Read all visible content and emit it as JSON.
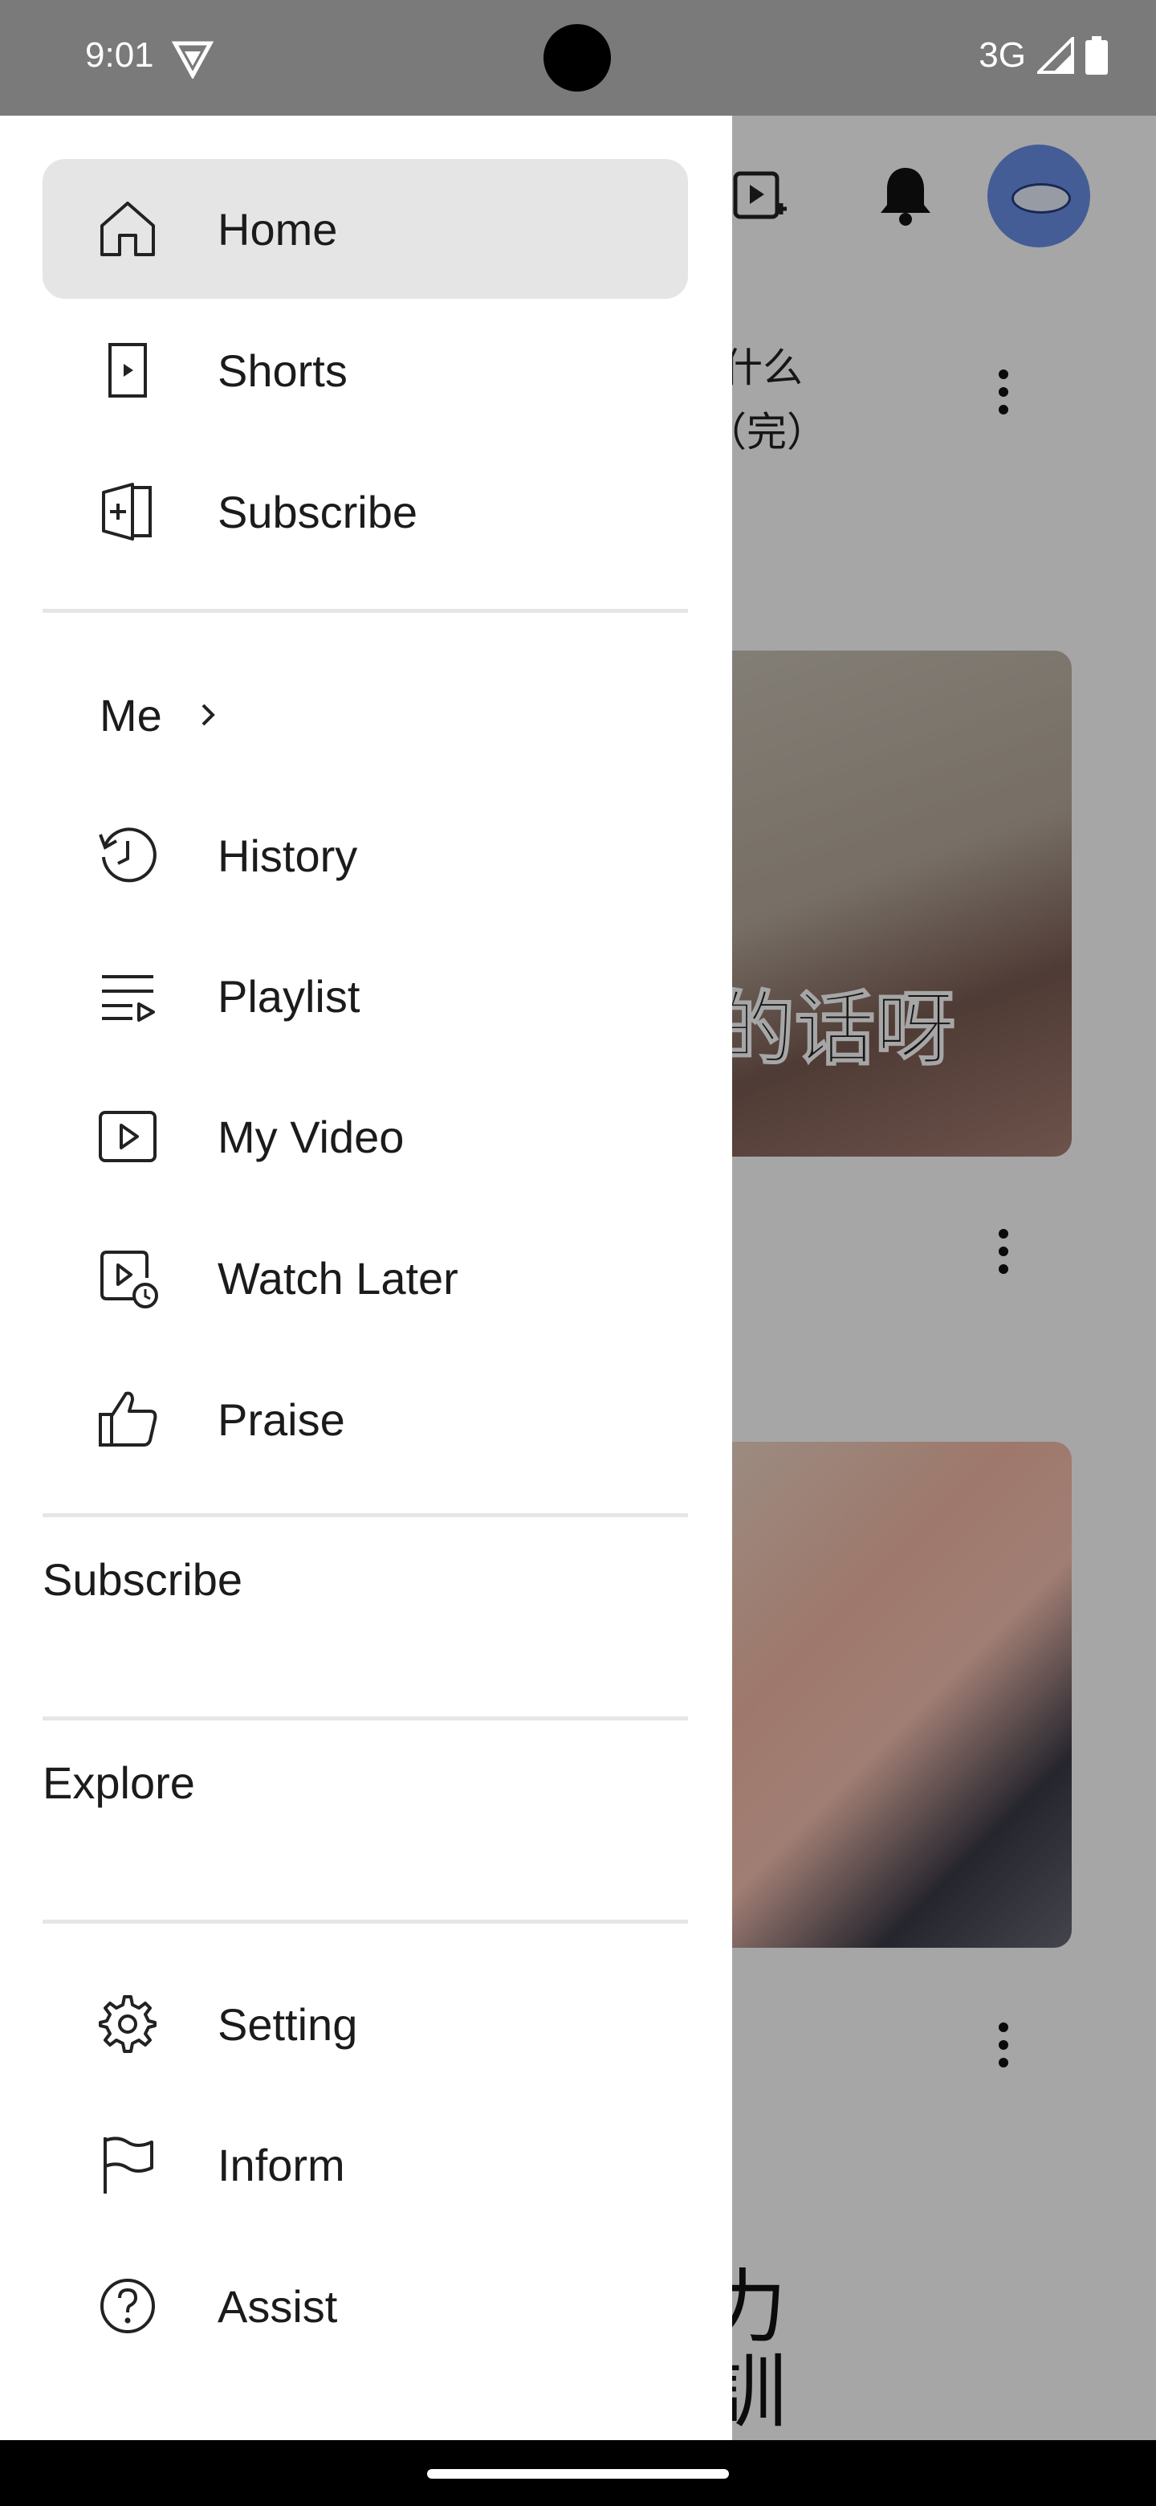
{
  "status_bar": {
    "time": "9:01",
    "network": "3G"
  },
  "drawer": {
    "top_items": [
      {
        "label": "Home",
        "icon": "home-icon",
        "active": true
      },
      {
        "label": "Shorts",
        "icon": "shorts-icon",
        "active": false
      },
      {
        "label": "Subscribe",
        "icon": "subscriptions-icon",
        "active": false
      }
    ],
    "me": {
      "label": "Me"
    },
    "me_items": [
      {
        "label": "History",
        "icon": "history-icon"
      },
      {
        "label": "Playlist",
        "icon": "playlist-icon"
      },
      {
        "label": "My Video",
        "icon": "my-video-icon"
      },
      {
        "label": "Watch Later",
        "icon": "watch-later-icon"
      },
      {
        "label": "Praise",
        "icon": "thumbs-up-icon"
      }
    ],
    "subscribe_section": "Subscribe",
    "explore_section": "Explore",
    "bottom_items": [
      {
        "label": "Setting",
        "icon": "gear-icon"
      },
      {
        "label": "Inform",
        "icon": "flag-icon"
      },
      {
        "label": "Assist",
        "icon": "help-icon"
      }
    ]
  },
  "background": {
    "video1_title_line1": "什么",
    "video1_title_line2": "（完）",
    "thumb1_caption": "的话呀",
    "bottom_text_line1": "力",
    "bottom_text_line2": "訓"
  },
  "colors": {
    "active_item_bg": "#e5e5e5",
    "avatar": "#6b8fe6",
    "status_bar": "#7a7a7a"
  }
}
